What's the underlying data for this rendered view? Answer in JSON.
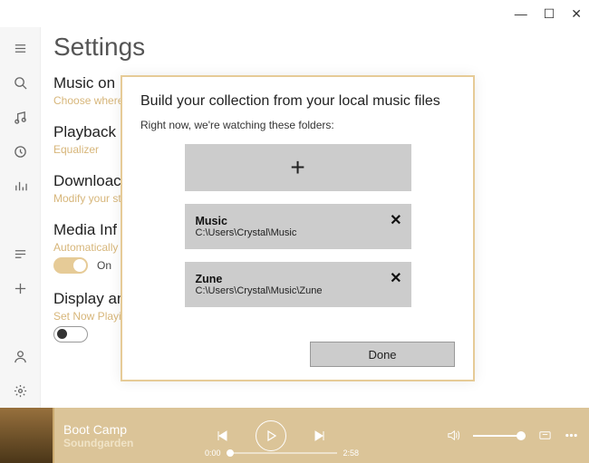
{
  "window": {
    "minimize": "—",
    "maximize": "☐",
    "close": "✕"
  },
  "page": {
    "title": "Settings",
    "sections": {
      "music": {
        "title": "Music on",
        "sub": "Choose where"
      },
      "playback": {
        "title": "Playback",
        "sub": "Equalizer"
      },
      "download": {
        "title": "Downloac",
        "sub": "Modify your st"
      },
      "media": {
        "title": "Media Inf",
        "sub": "Automatically",
        "toggle": "On"
      },
      "display": {
        "title": "Display an",
        "sub": "Set Now Playin",
        "toggle": "Off"
      }
    }
  },
  "dialog": {
    "title": "Build your collection from your local music files",
    "subtitle": "Right now, we're watching these folders:",
    "folders": [
      {
        "name": "Music",
        "path": "C:\\Users\\Crystal\\Music"
      },
      {
        "name": "Zune",
        "path": "C:\\Users\\Crystal\\Music\\Zune"
      }
    ],
    "done": "Done"
  },
  "player": {
    "title": "Boot Camp",
    "artist": "Soundgarden",
    "elapsed": "0:00",
    "duration": "2:58"
  }
}
